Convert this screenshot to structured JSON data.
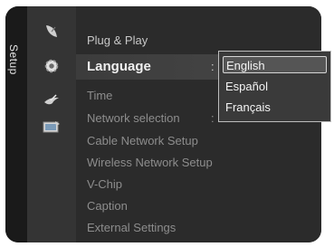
{
  "menu": {
    "category": "Setup",
    "items": [
      {
        "label": "Plug & Play"
      },
      {
        "label": "Language"
      },
      {
        "label": "Time"
      },
      {
        "label": "Network selection"
      },
      {
        "label": "Cable Network Setup"
      },
      {
        "label": "Wireless Network Setup"
      },
      {
        "label": "V-Chip"
      },
      {
        "label": "Caption"
      },
      {
        "label": "External Settings"
      }
    ],
    "separator": ":"
  },
  "icons": [
    "satellite-dish-icon",
    "gear-icon",
    "bird-icon",
    "tv-screen-icon"
  ],
  "language_dropdown": {
    "options": [
      "English",
      "Español",
      "Français"
    ],
    "selected": "English"
  },
  "colors": {
    "panel": "#2a2a2a",
    "highlight_border": "#d6d6d6",
    "text": "#f0f0f0",
    "dim_text": "#8d8d8d"
  }
}
